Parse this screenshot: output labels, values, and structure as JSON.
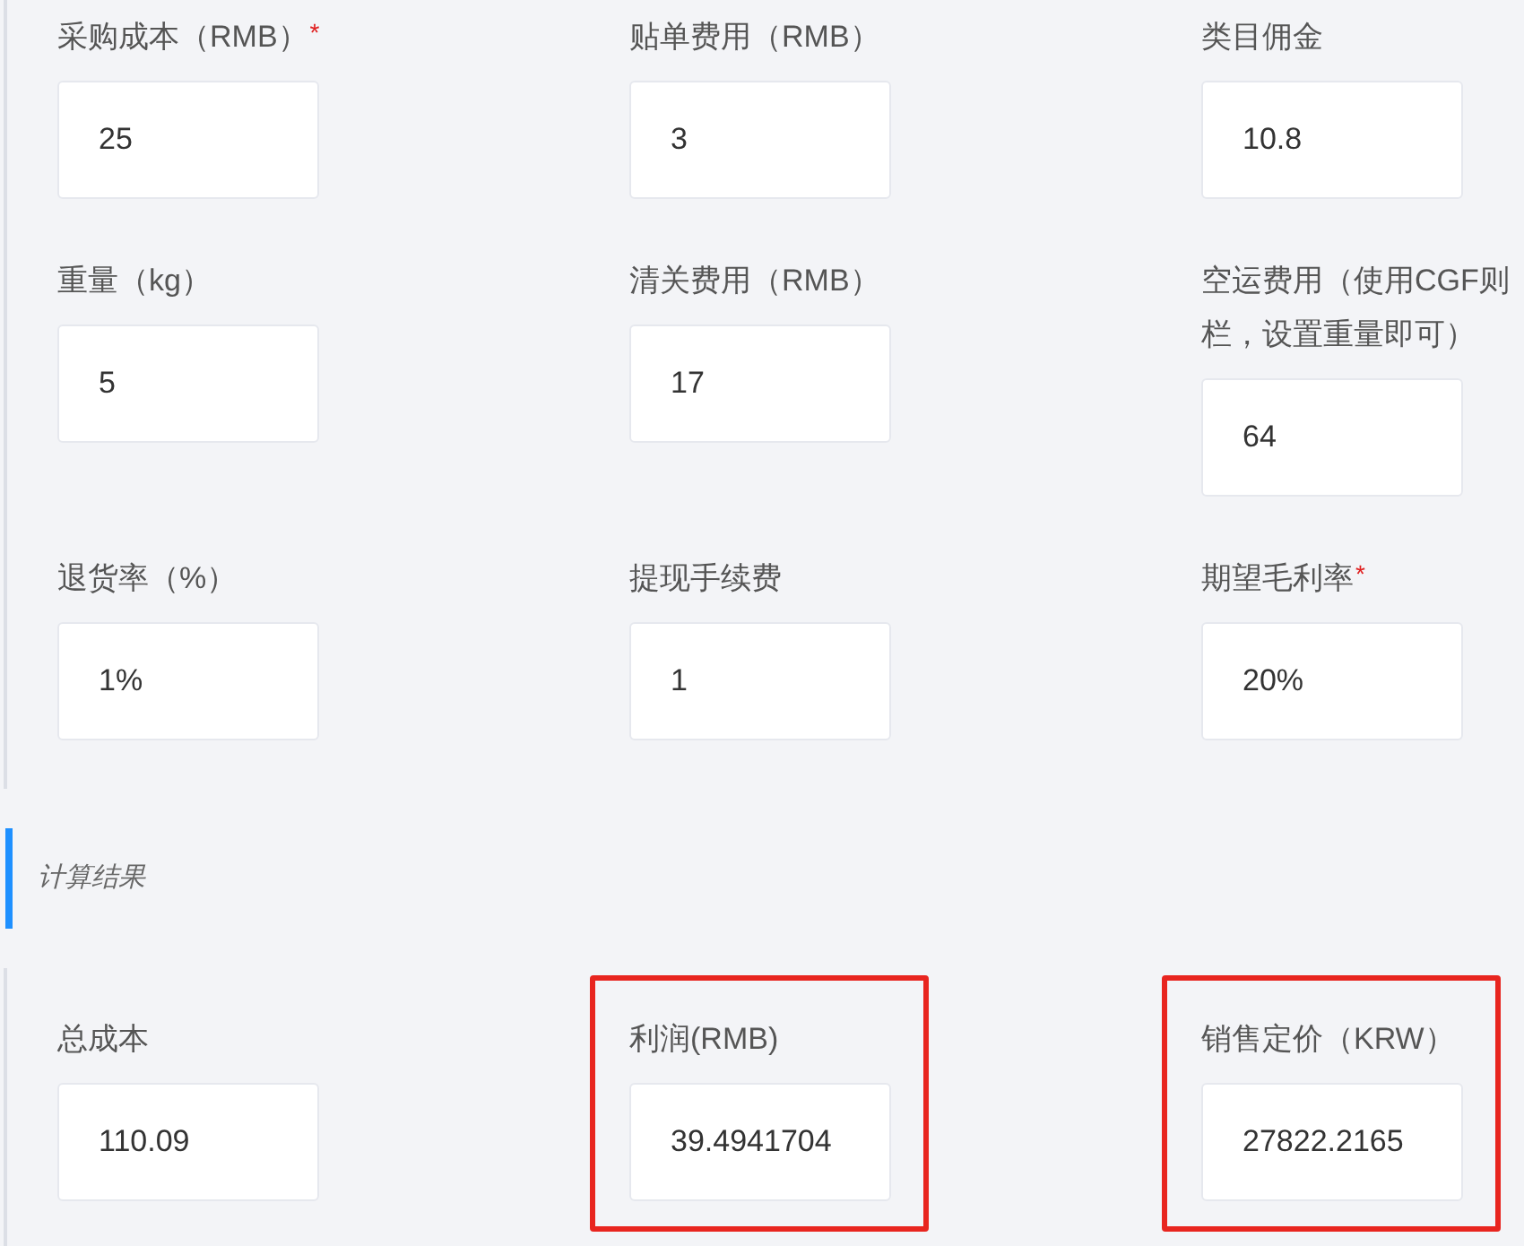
{
  "input_fields": [
    {
      "label_lines": [
        "采购成本（RMB）"
      ],
      "required_mark": "*",
      "value": "25"
    },
    {
      "label_lines": [
        "贴单费用（RMB）"
      ],
      "value": "3"
    },
    {
      "label_lines": [
        "类目佣金"
      ],
      "value": "10.8"
    },
    {
      "label_lines": [
        "重量（kg）"
      ],
      "value": "5"
    },
    {
      "label_lines": [
        "清关费用（RMB）"
      ],
      "value": "17"
    },
    {
      "label_lines": [
        "空运费用（使用CGF则",
        "栏，设置重量即可）"
      ],
      "value": "64"
    },
    {
      "label_lines": [
        "退货率（%）"
      ],
      "value": "1%"
    },
    {
      "label_lines": [
        "提现手续费"
      ],
      "value": "1"
    },
    {
      "label_lines": [
        "期望毛利率"
      ],
      "required_mark": "*",
      "value": "20%"
    }
  ],
  "results_section": {
    "title": "计算结果"
  },
  "result_fields": [
    {
      "label_lines": [
        "总成本"
      ],
      "highlighted": false,
      "value": "110.09"
    },
    {
      "label_lines": [
        "利润(RMB)"
      ],
      "highlighted": true,
      "value": "39.4941704"
    },
    {
      "label_lines": [
        "销售定价（KRW）"
      ],
      "highlighted": true,
      "value": "27822.2165"
    }
  ]
}
